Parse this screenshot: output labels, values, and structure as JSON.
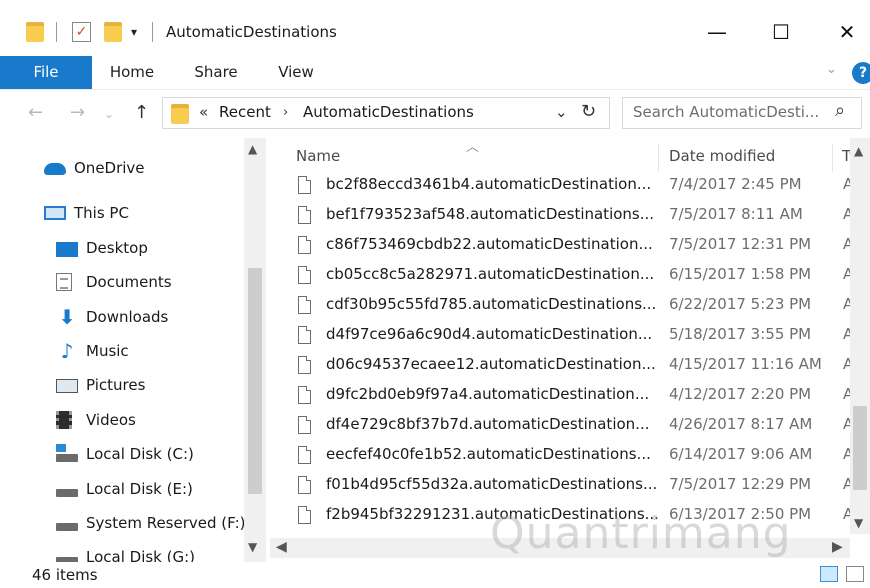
{
  "window": {
    "title": "AutomaticDestinations",
    "controls": [
      "—",
      "☐",
      "✕"
    ]
  },
  "ribbon": {
    "tabs": [
      "File",
      "Home",
      "Share",
      "View"
    ]
  },
  "address": {
    "chevrons": "«",
    "crumbs": [
      "Recent",
      "AutomaticDestinations"
    ],
    "separator": "›"
  },
  "search": {
    "placeholder": "Search AutomaticDesti..."
  },
  "nav": {
    "items": [
      {
        "label": "OneDrive",
        "icon": "cloud-icon"
      },
      {
        "label": "This PC",
        "icon": "computer-icon"
      },
      {
        "label": "Desktop",
        "icon": "desktop-icon"
      },
      {
        "label": "Documents",
        "icon": "documents-icon"
      },
      {
        "label": "Downloads",
        "icon": "download-arrow-icon"
      },
      {
        "label": "Music",
        "icon": "music-note-icon"
      },
      {
        "label": "Pictures",
        "icon": "pictures-icon"
      },
      {
        "label": "Videos",
        "icon": "film-icon"
      },
      {
        "label": "Local Disk (C:)",
        "icon": "disk-windows-icon"
      },
      {
        "label": "Local Disk (E:)",
        "icon": "disk-icon"
      },
      {
        "label": "System Reserved (F:)",
        "icon": "disk-icon"
      },
      {
        "label": "Local Disk (G:)",
        "icon": "disk-icon"
      }
    ]
  },
  "files": {
    "columns": {
      "name": "Name",
      "date": "Date modified",
      "type": "Ty"
    },
    "rows": [
      {
        "name": "bc2f88eccd3461b4.automaticDestination...",
        "date": "7/4/2017 2:45 PM",
        "type": "AU"
      },
      {
        "name": "bef1f793523af548.automaticDestinations...",
        "date": "7/5/2017 8:11 AM",
        "type": "AU"
      },
      {
        "name": "c86f753469cbdb22.automaticDestination...",
        "date": "7/5/2017 12:31 PM",
        "type": "AU"
      },
      {
        "name": "cb05cc8c5a282971.automaticDestination...",
        "date": "6/15/2017 1:58 PM",
        "type": "AU"
      },
      {
        "name": "cdf30b95c55fd785.automaticDestinations...",
        "date": "6/22/2017 5:23 PM",
        "type": "AU"
      },
      {
        "name": "d4f97ce96a6c90d4.automaticDestination...",
        "date": "5/18/2017 3:55 PM",
        "type": "AU"
      },
      {
        "name": "d06c94537ecaee12.automaticDestination...",
        "date": "4/15/2017 11:16 AM",
        "type": "AU"
      },
      {
        "name": "d9fc2bd0eb9f97a4.automaticDestination...",
        "date": "4/12/2017 2:20 PM",
        "type": "AU"
      },
      {
        "name": "df4e729c8bf37b7d.automaticDestination...",
        "date": "4/26/2017 8:17 AM",
        "type": "AU"
      },
      {
        "name": "eecfef40c0fe1b52.automaticDestinations...",
        "date": "6/14/2017 9:06 AM",
        "type": "AU"
      },
      {
        "name": "f01b4d95cf55d32a.automaticDestinations...",
        "date": "7/5/2017 12:29 PM",
        "type": "AU"
      },
      {
        "name": "f2b945bf32291231.automaticDestinations...",
        "date": "6/13/2017 2:50 PM",
        "type": "AU"
      }
    ]
  },
  "status": {
    "count": "46 items"
  },
  "watermark": "Quantrimang",
  "colors": {
    "accent": "#1979ca",
    "folder": "#f6cd4f"
  }
}
